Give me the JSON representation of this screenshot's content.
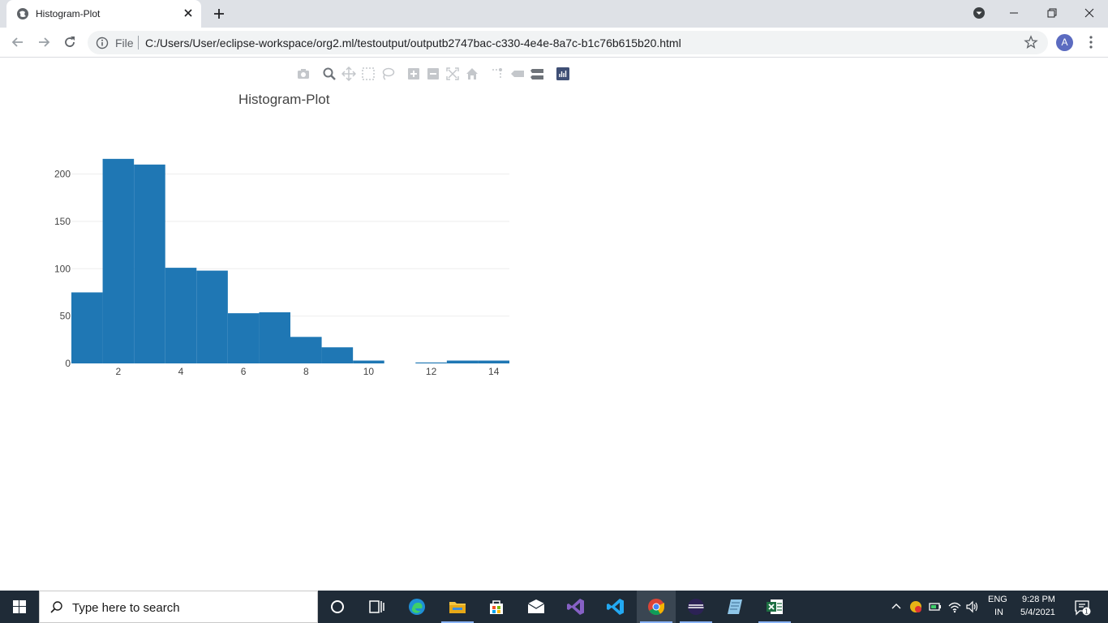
{
  "browser": {
    "tab_title": "Histogram-Plot",
    "url_scheme_label": "File",
    "url": "C:/Users/User/eclipse-workspace/org2.ml/testoutput/outputb2747bac-c330-4e4e-8a7c-b1c76b615b20.html",
    "avatar_letter": "A"
  },
  "chart_data": {
    "type": "bar",
    "title": "Histogram-Plot",
    "xlabel": "",
    "ylabel": "",
    "bin_start": 0.5,
    "bin_width": 1,
    "values": [
      75,
      216,
      210,
      101,
      98,
      53,
      54,
      28,
      17,
      3,
      0,
      1,
      3,
      3
    ],
    "x_ticks": [
      2,
      4,
      6,
      8,
      10,
      12,
      14
    ],
    "y_ticks": [
      0,
      50,
      100,
      150,
      200
    ],
    "xlim": [
      0.5,
      14.5
    ],
    "ylim": [
      0,
      227
    ],
    "grid": true,
    "bar_color": "#1f77b4",
    "grid_color": "#eeeeee"
  },
  "taskbar": {
    "search_placeholder": "Type here to search",
    "lang_line1": "ENG",
    "lang_line2": "IN",
    "time": "9:28 PM",
    "date": "5/4/2021",
    "notification_count": "1"
  }
}
